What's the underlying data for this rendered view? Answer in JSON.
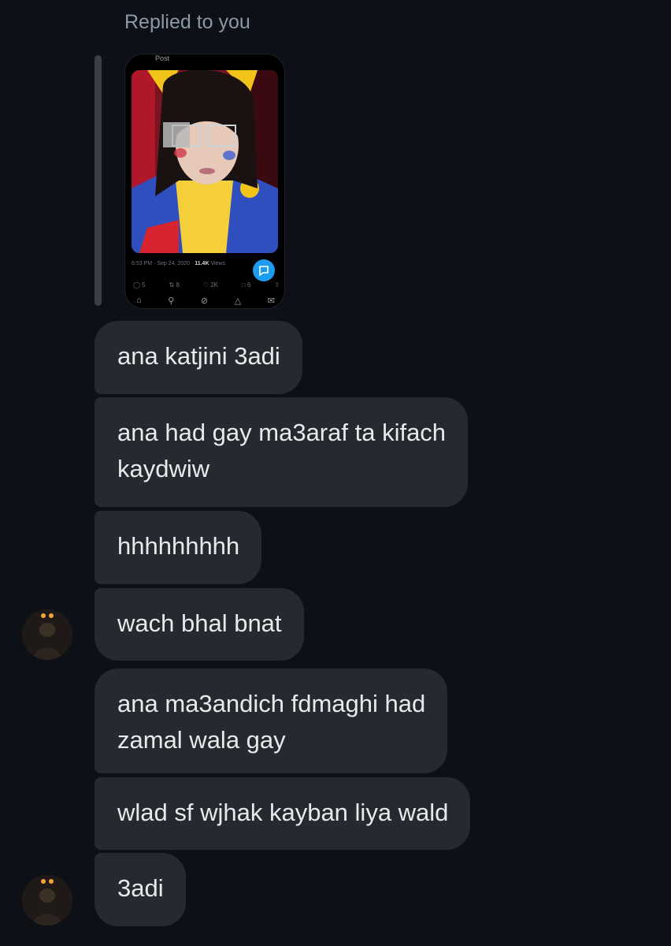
{
  "conversation": {
    "reply_header": "Replied to you",
    "quoted_post": {
      "label": "Post",
      "meta": {
        "time": "6:53 PM",
        "date": "Sep 24, 2020",
        "views_count": "11.4K",
        "views_label": "Views"
      },
      "actions": {
        "replies": "5",
        "reposts": "8",
        "likes": "2K",
        "bookmarks": "6"
      }
    },
    "messages": [
      {
        "text": "ana katjini 3adi"
      },
      {
        "text": "ana had gay ma3araf ta kifach\nkaydwiw"
      },
      {
        "text": "hhhhhhhhh"
      },
      {
        "text": "wach bhal bnat"
      },
      {
        "text": "ana ma3andich fdmaghi had\nzamal wala gay"
      },
      {
        "text": "wlad sf wjhak kayban liya wald"
      },
      {
        "text": "3adi"
      }
    ]
  },
  "colors": {
    "background": "#0d1117",
    "bubble": "#252a31",
    "text": "#e7e9ea",
    "muted": "#8b98a5",
    "accent": "#1d9bf0"
  }
}
